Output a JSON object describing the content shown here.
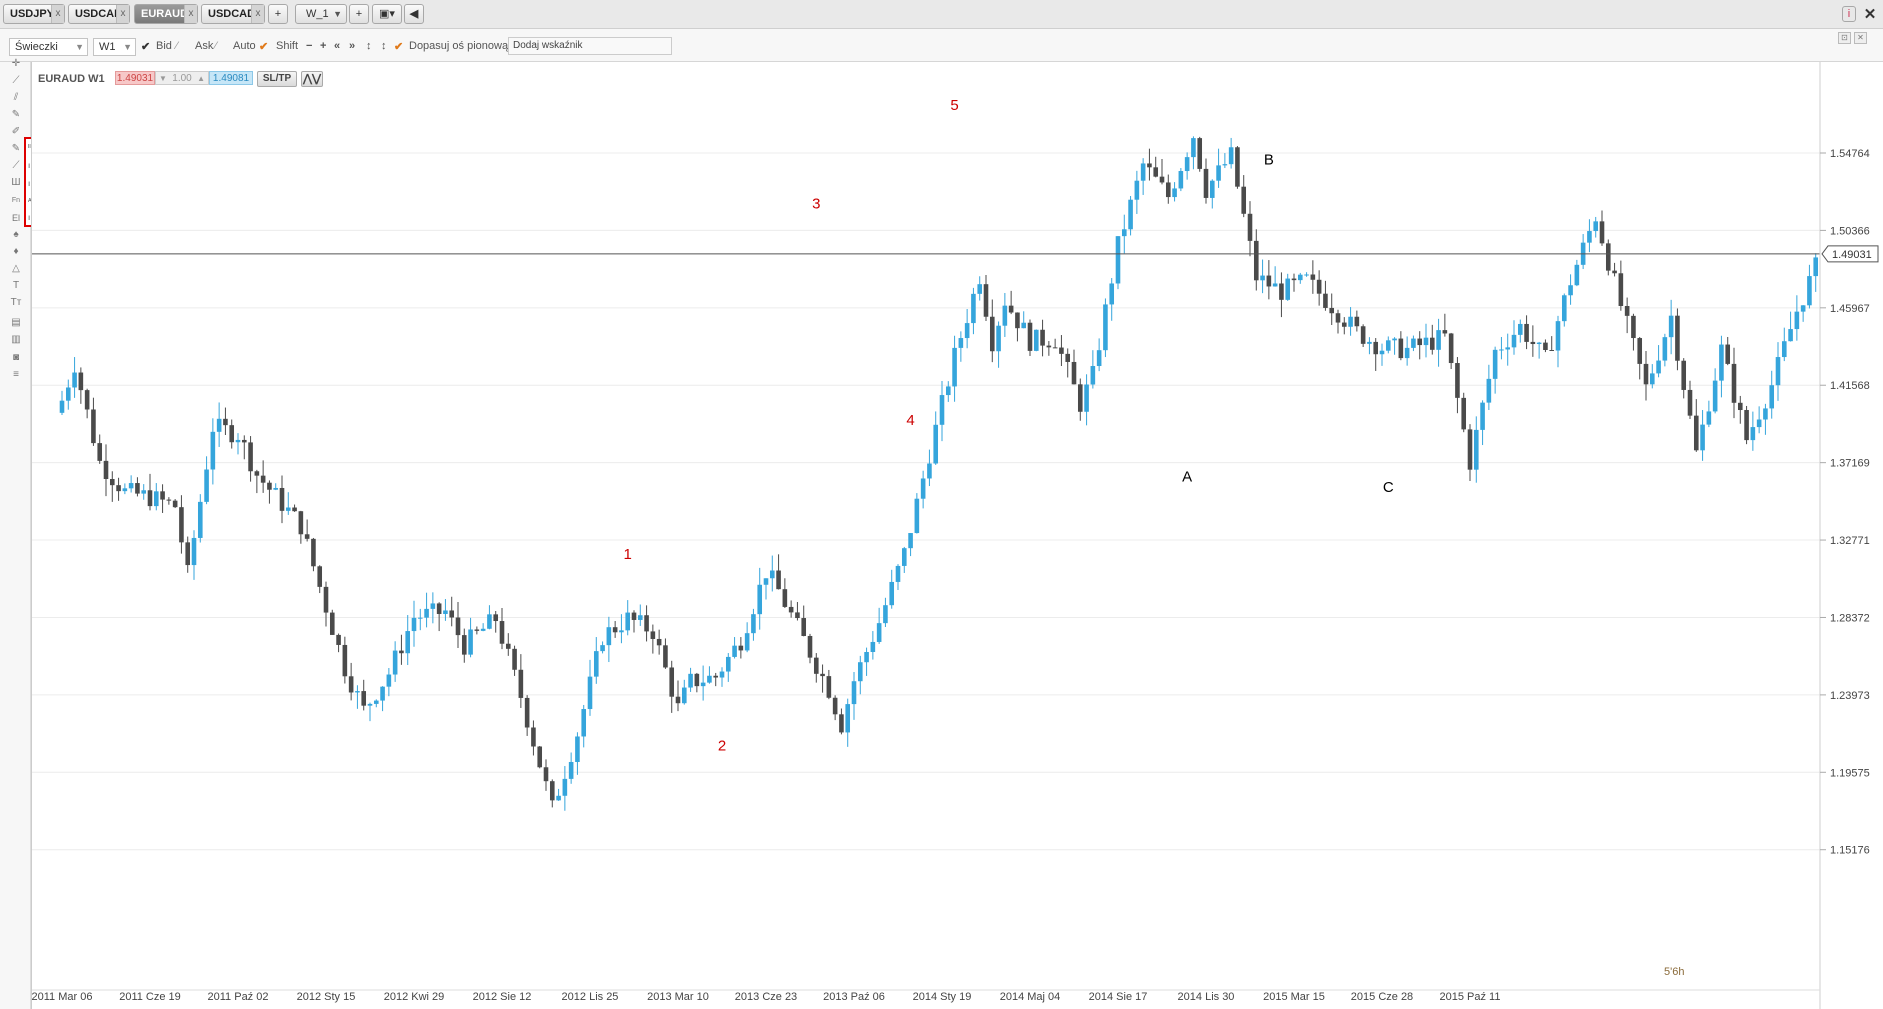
{
  "tabs": [
    {
      "label": "USDJPY",
      "close": "x"
    },
    {
      "label": "USDCAD",
      "close": "x"
    },
    {
      "label": "EURAUD",
      "close": "x",
      "active": true
    },
    {
      "label": "USDCAD",
      "close": "x"
    }
  ],
  "tabbar": {
    "add_label": "+",
    "tf_value": "W_1",
    "tf_plus": "+"
  },
  "toolbar": {
    "chart_type": "Świeczki",
    "interval": "W1",
    "bid_label": "Bid",
    "ask_label": "Ask",
    "auto_label": "Auto",
    "shift_label": "Shift",
    "fit_label": "Dopasuj oś pionową",
    "indicator_placeholder": "Dodaj wskaźnik"
  },
  "instrument": {
    "symbol": "EURAUD W1",
    "sell_price": "1.49031",
    "lot": "1.00",
    "buy_price": "1.49081",
    "sltp_label": "SL/TP"
  },
  "chart_data": {
    "type": "candlestick",
    "title": "EURAUD W1",
    "current_price_label": "1.49031",
    "current_price": 1.49031,
    "y_ticks": [
      "1.54764",
      "1.50366",
      "1.45967",
      "1.41568",
      "1.37169",
      "1.32771",
      "1.28372",
      "1.23973",
      "1.19575",
      "1.15176"
    ],
    "x_ticks": [
      "2011 Mar 06",
      "2011 Cze 19",
      "2011 Paź 02",
      "2012 Sty 15",
      "2012 Kwi 29",
      "2012 Sie 12",
      "2012 Lis 25",
      "2013 Mar 10",
      "2013 Cze 23",
      "2013 Paź 06",
      "2014 Sty 19",
      "2014 Maj 04",
      "2014 Sie 17",
      "2014 Lis 30",
      "2015 Mar 15",
      "2015 Cze 28",
      "2015 Paź 11"
    ],
    "timer_label": "5'6h",
    "annotations": [
      {
        "text": "1",
        "color": "#cc0000",
        "x": "2012 Lis 25",
        "y": 1.317
      },
      {
        "text": "2",
        "color": "#cc0000",
        "x": "2013 Mar 10",
        "y": 1.208
      },
      {
        "text": "3",
        "color": "#cc0000",
        "x": "2013 Cze 23",
        "y": 1.516
      },
      {
        "text": "4",
        "color": "#cc0000",
        "x": "2013 Paź 06",
        "y": 1.393
      },
      {
        "text": "5",
        "color": "#cc0000",
        "x": "2013 Lis 24",
        "y": 1.572
      },
      {
        "text": "A",
        "color": "#000000",
        "x": "2014 Sie 10",
        "y": 1.361
      },
      {
        "text": "B",
        "color": "#000000",
        "x": "2014 Lis 09",
        "y": 1.541
      },
      {
        "text": "C",
        "color": "#000000",
        "x": "2015 Mar 22",
        "y": 1.355
      }
    ],
    "ohlc": []
  }
}
